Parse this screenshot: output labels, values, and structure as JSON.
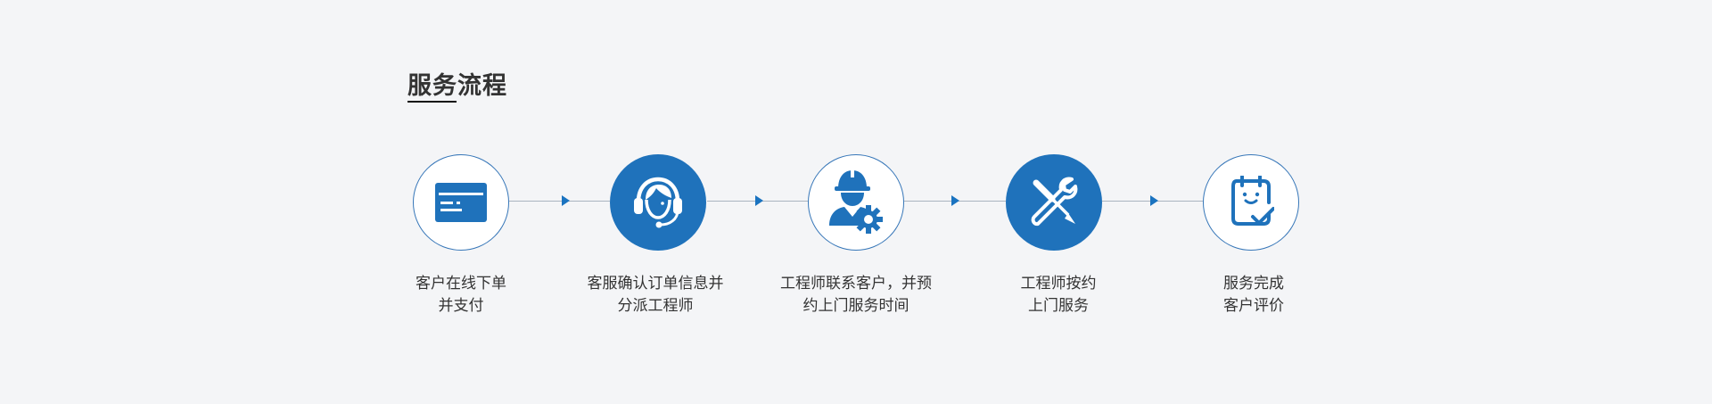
{
  "section": {
    "title": "服务流程"
  },
  "colors": {
    "brand_blue": "#1f72bb",
    "arrow_blue": "#1a73c0",
    "background": "#f4f5f7",
    "text": "#333333"
  },
  "steps": [
    {
      "icon": "credit-card-icon",
      "style": "outline",
      "label_line1": "客户在线下单",
      "label_line2": "并支付"
    },
    {
      "icon": "customer-service-headset-icon",
      "style": "filled",
      "label_line1": "客服确认订单信息并",
      "label_line2": "分派工程师"
    },
    {
      "icon": "engineer-gear-icon",
      "style": "outline",
      "label_line1": "工程师联系客户，并预",
      "label_line2": "约上门服务时间"
    },
    {
      "icon": "tools-wrench-screwdriver-icon",
      "style": "filled",
      "label_line1": "工程师按约",
      "label_line2": "上门服务"
    },
    {
      "icon": "evaluation-clipboard-icon",
      "style": "outline",
      "label_line1": "服务完成",
      "label_line2": "客户评价"
    }
  ]
}
